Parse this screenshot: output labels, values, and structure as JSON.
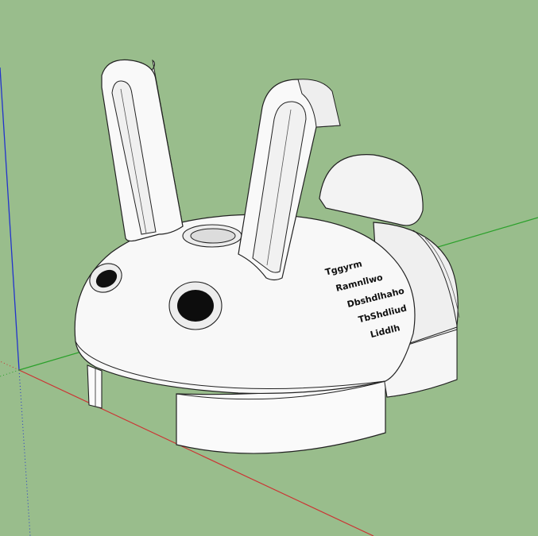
{
  "app": {
    "name": "3D modeling viewport"
  },
  "viewport": {
    "background": "#99bd8c",
    "axes": {
      "x_color": "#cc3333",
      "y_color": "#2aa02a",
      "z_color": "#2233cc"
    }
  },
  "model": {
    "description_icon": "bunny-head-3d-model",
    "engraved_text": [
      "Tggyrm",
      "Ramnllwo",
      "Dbshdlhaho",
      "TbShdliud",
      "Liddlh"
    ]
  }
}
